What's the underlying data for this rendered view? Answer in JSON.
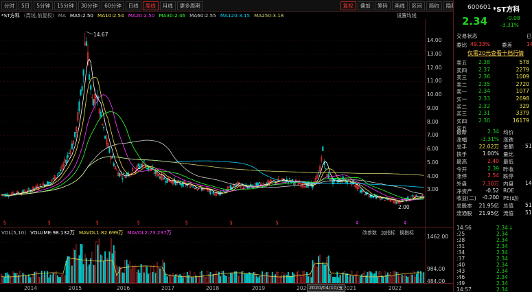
{
  "toolbar": {
    "items": [
      "分时",
      "5日",
      "5分钟",
      "15分钟",
      "30分钟",
      "60分钟",
      "日线",
      "周线",
      "月线",
      "更多周期",
      "复权",
      "叠加",
      "筹码",
      "画线",
      "区间",
      "简约",
      "隐藏"
    ]
  },
  "legend": {
    "title": "*ST方科",
    "subtitle": "(周线,前复权)",
    "ma": "MA",
    "ma5": "MA5:2.50",
    "ma10": "MA10:2.54",
    "ma20": "MA20:2.50",
    "ma30": "MA30:2.46",
    "ma60": "MA60:2.55",
    "ma120": "MA120:3.15",
    "ma250": "MA250:3.18",
    "setting": "设置均线"
  },
  "colors": {
    "ma5": "#ffffff",
    "ma10": "#f2e24a",
    "ma20": "#ff40ff",
    "ma30": "#32ff32",
    "ma60": "#d0d0d0",
    "ma120": "#00d8ff",
    "ma250": "#d8d870",
    "up": "#ff3b3b",
    "down": "#00c8c8"
  },
  "price_axis": [
    "14.00",
    "13.00",
    "12.00",
    "11.00",
    "10.00",
    "9.00",
    "8.00",
    "7.00",
    "6.00",
    "5.00",
    "4.00",
    "3.00"
  ],
  "high_label": "14.67",
  "low_label": "2.00",
  "volume": {
    "legend": "VOL(5,10)",
    "vol": "VOLUME:98.132万",
    "mavol1": "MAVOL1:82.699万",
    "mavol2": "MAVOL2:73.297万",
    "tools": [
      "改参数",
      "加指标",
      "换指标"
    ],
    "axis": [
      "1462.00",
      "984.00",
      "484.00"
    ]
  },
  "xaxis": [
    "2014",
    "2015",
    "2016",
    "2017",
    "2018",
    "2019",
    "2020",
    "2021",
    "2022"
  ],
  "crosshair_date": "2020/04/10/五",
  "stock": {
    "code": "600601",
    "name": "*ST方科",
    "price": "2.34",
    "change": "-0.08",
    "pct": "-3.31%"
  },
  "status": {
    "label": "交易状态",
    "value": "已",
    "weibi_label": "委比",
    "weibi": "49.33%",
    "weicha_label": "委差",
    "weicha": "14"
  },
  "promo": "仅需20元查看十档行情",
  "asks": [
    {
      "l": "卖五",
      "p": "2.38",
      "v": "578"
    },
    {
      "l": "卖四",
      "p": "2.37",
      "v": "2279"
    },
    {
      "l": "卖三",
      "p": "2.36",
      "v": "1009"
    },
    {
      "l": "卖二",
      "p": "2.35",
      "v": "2720"
    },
    {
      "l": "卖一",
      "p": "2.34",
      "v": "1077"
    }
  ],
  "bids": [
    {
      "l": "买一",
      "p": "2.33",
      "v": "2698"
    },
    {
      "l": "买二",
      "p": "2.32",
      "v": "329"
    },
    {
      "l": "买三",
      "p": "2.31",
      "v": "3379"
    },
    {
      "l": "买四",
      "p": "2.30",
      "v": "16179"
    },
    {
      "l": "买五",
      "p": "",
      "v": ""
    }
  ],
  "stats": [
    {
      "a": "最新",
      "b": "2.34",
      "c": "均价",
      "d": "",
      "bc": "dn"
    },
    {
      "a": "涨幅",
      "b": "-3.31%",
      "c": "涨跌",
      "d": "",
      "bc": "dn"
    },
    {
      "a": "总手",
      "b": "22.02万",
      "c": "金额",
      "d": "51",
      "bc": "yl"
    },
    {
      "a": "换手",
      "b": "1.00%",
      "c": "量比",
      "d": "",
      "bc": "wh"
    },
    {
      "a": "最高",
      "b": "2.40",
      "c": "最低",
      "d": "",
      "bc": "up"
    },
    {
      "a": "今开",
      "b": "2.39",
      "c": "昨收",
      "d": "",
      "bc": "dn"
    },
    {
      "a": "涨停",
      "b": "2.54",
      "c": "跌停",
      "d": "",
      "bc": "up"
    },
    {
      "a": "外盘",
      "b": "7.30万",
      "c": "内盘",
      "d": "14.",
      "bc": "up"
    },
    {
      "a": "净资产",
      "b": "-0.52",
      "c": "ROE",
      "d": "",
      "bc": "wh"
    },
    {
      "a": "收益(二)",
      "b": "-0.200",
      "c": "PE(动)",
      "d": "",
      "bc": "wh"
    },
    {
      "a": "总股本",
      "b": "21.95亿",
      "c": "总值",
      "d": "51.3",
      "bc": "wh"
    },
    {
      "a": "流通股",
      "b": "21.95亿",
      "c": "流值",
      "d": "51.3",
      "bc": "wh"
    }
  ],
  "ticks": [
    {
      "t": "14:56",
      "p": "2.34",
      "m": "↓"
    },
    {
      "t": ":25",
      "p": "2.34"
    },
    {
      "t": ":28",
      "p": "2.34"
    },
    {
      "t": ":31",
      "p": "2.34"
    },
    {
      "t": ":34",
      "p": "2.34"
    },
    {
      "t": ":37",
      "p": "2.34"
    },
    {
      "t": ":40",
      "p": "2.34"
    },
    {
      "t": ":43",
      "p": "2.34"
    },
    {
      "t": ":46",
      "p": "2.34"
    },
    {
      "t": ":49",
      "p": "2.34"
    },
    {
      "t": "14:57",
      "p": "2.34"
    }
  ]
}
